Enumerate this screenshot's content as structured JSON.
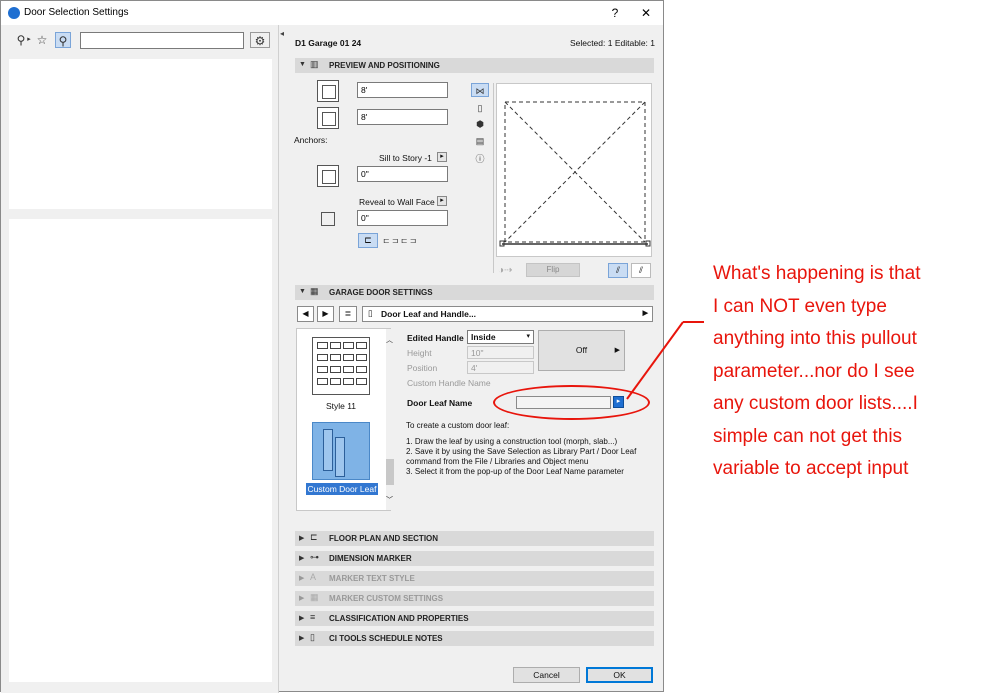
{
  "window": {
    "title": "Door Selection Settings",
    "help": "?",
    "close": "✕"
  },
  "left_toolbar": {
    "search_value": ""
  },
  "header": {
    "object_name": "D1 Garage 01 24",
    "selection_info": "Selected: 1 Editable: 1"
  },
  "preview": {
    "section_label": "PREVIEW AND POSITIONING",
    "width_value": "8'",
    "height_value": "8'",
    "anchors_label": "Anchors:",
    "sill_label": "Sill to Story -1",
    "sill_value": "0\"",
    "reveal_label": "Reveal to Wall Face",
    "reveal_value": "0\"",
    "flip_label": "Flip"
  },
  "garage": {
    "section_label": "GARAGE DOOR SETTINGS",
    "page_name": "Door Leaf and Handle...",
    "style_caption": "Style 11",
    "custom_caption": "Custom Door Leaf",
    "edited_handle_label": "Edited Handle",
    "edited_handle_value": "Inside",
    "height_label": "Height",
    "height_value": "10\"",
    "position_label": "Position",
    "position_value": "4'",
    "custom_handle_label": "Custom Handle Name",
    "off_label": "Off",
    "door_leaf_name_label": "Door Leaf Name",
    "door_leaf_name_value": "",
    "note_1": "To create a custom door leaf:",
    "note_2": "1. Draw the leaf by using a construction tool (morph, slab...)",
    "note_3": "2. Save it by using the Save Selection as Library Part / Door Leaf command from the File / Libraries and Object menu",
    "note_4": "3. Select it from the pop-up of the Door Leaf Name parameter"
  },
  "sections": [
    {
      "label": "FLOOR PLAN AND SECTION"
    },
    {
      "label": "DIMENSION MARKER"
    },
    {
      "label": "MARKER TEXT STYLE"
    },
    {
      "label": "MARKER CUSTOM SETTINGS"
    },
    {
      "label": "CLASSIFICATION AND PROPERTIES"
    },
    {
      "label": "CI TOOLS SCHEDULE NOTES"
    }
  ],
  "buttons": {
    "cancel": "Cancel",
    "ok": "OK"
  },
  "annotation": {
    "lines": [
      "What's happening is that",
      "I can NOT even type",
      "anything into this pullout",
      "parameter...nor do I see",
      "any custom door lists....I",
      "simple can not get this",
      "variable to accept input"
    ],
    "color": "#e8150c"
  }
}
